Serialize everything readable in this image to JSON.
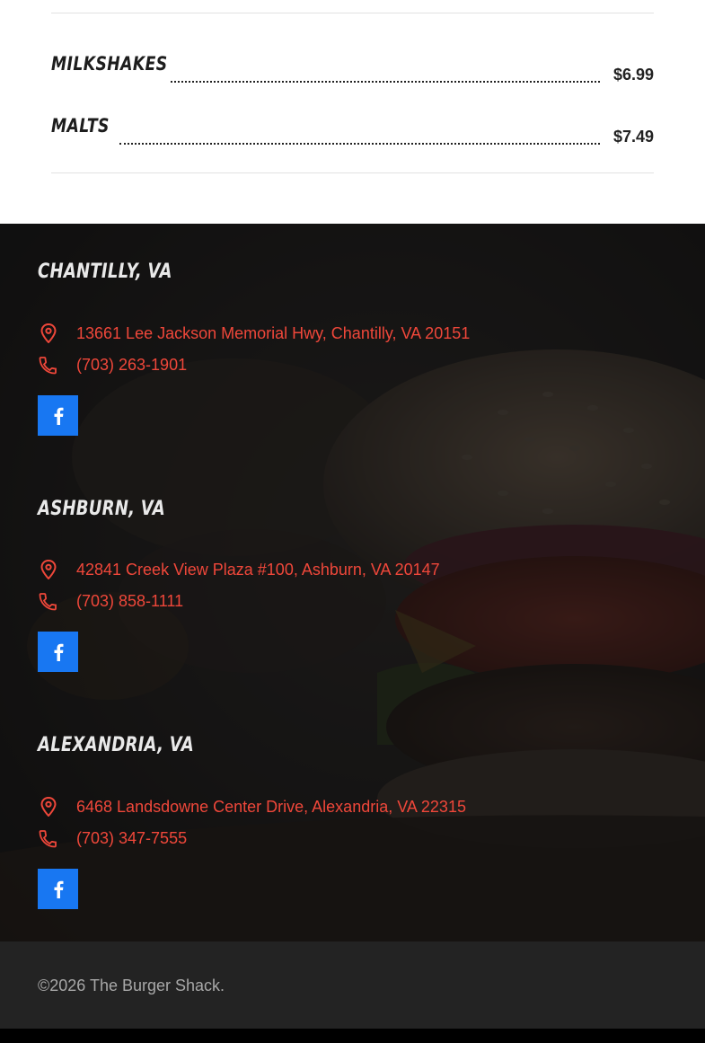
{
  "menu": {
    "items": [
      {
        "name": "Milkshakes",
        "price": "$6.99"
      },
      {
        "name": "Malts",
        "price": "$7.49"
      }
    ]
  },
  "locations": [
    {
      "title": "Chantilly, VA",
      "address": "13661 Lee Jackson Memorial Hwy, Chantilly, VA 20151",
      "phone": "(703) 263-1901"
    },
    {
      "title": "Ashburn, VA",
      "address": "42841 Creek View Plaza #100, Ashburn, VA 20147",
      "phone": "(703) 858-1111"
    },
    {
      "title": "Alexandria, VA",
      "address": "6468 Landsdowne Center Drive, Alexandria, VA 22315",
      "phone": "(703) 347-7555"
    }
  ],
  "icons": {
    "address": "map-pin-icon",
    "phone": "phone-icon",
    "social": "facebook-icon"
  },
  "colors": {
    "accent": "#ef473a",
    "facebook": "#1877f2",
    "footer_bg": "#232323",
    "section_bg": "#141313"
  },
  "footer": {
    "copyright": "©2026 The Burger Shack."
  }
}
